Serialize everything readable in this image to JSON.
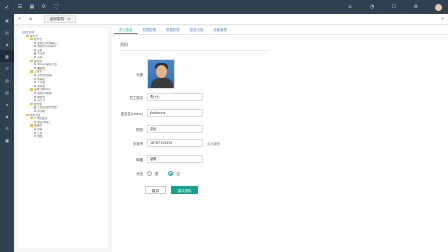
{
  "tab": {
    "label": "组织架构",
    "close": "×"
  },
  "tree": {
    "root": "[我的]权限",
    "nodes": [
      {
        "type": "folder",
        "label": "曹六七",
        "indent": 1
      },
      {
        "type": "folder",
        "label": "研六七",
        "indent": 2
      },
      {
        "type": "user",
        "label": "张晓(贝尔)的职工",
        "indent": 3
      },
      {
        "type": "user",
        "label": "刘晓宁(Amgen)",
        "indent": 3
      },
      {
        "type": "user",
        "label": "庄斯",
        "indent": 3
      },
      {
        "type": "user",
        "label": "李子彦",
        "indent": 3
      },
      {
        "type": "user",
        "label": "苏丹",
        "indent": 3
      },
      {
        "type": "folder",
        "label": "运营部",
        "indent": 2
      },
      {
        "type": "user",
        "label": "Xinyu(深圳)上班",
        "indent": 3
      },
      {
        "type": "user",
        "label": "曹六七",
        "indent": 3,
        "selected": true
      },
      {
        "type": "folder",
        "label": "工程部",
        "indent": 2
      },
      {
        "type": "user",
        "label": "乔文杰(新闻)",
        "indent": 3
      },
      {
        "type": "user",
        "label": "刘林研",
        "indent": 3
      },
      {
        "type": "user",
        "label": "王小波",
        "indent": 3
      },
      {
        "type": "user",
        "label": "周丹研",
        "indent": 3
      },
      {
        "type": "folder",
        "label": "深圳分部DCA",
        "indent": 2
      },
      {
        "type": "user",
        "label": "胡晓(市场部)",
        "indent": 3
      },
      {
        "type": "user",
        "label": "杨文彦",
        "indent": 3
      },
      {
        "type": "user",
        "label": "马小飞",
        "indent": 3
      },
      {
        "type": "folder",
        "label": "财务部",
        "indent": 2
      },
      {
        "type": "user",
        "label": "王丹晨(财务主管)",
        "indent": 3
      },
      {
        "type": "user",
        "label": "周小楠",
        "indent": 3
      },
      {
        "type": "folder",
        "label": "财务九部",
        "indent": 1
      },
      {
        "type": "folder",
        "label": "广州研发部",
        "indent": 2
      },
      {
        "type": "user",
        "label": "周丹(测试)",
        "indent": 3
      },
      {
        "type": "folder",
        "label": "视频部",
        "indent": 2
      },
      {
        "type": "user",
        "label": "韩丽",
        "indent": 3
      },
      {
        "type": "user",
        "label": "江丹",
        "indent": 3
      },
      {
        "type": "user",
        "label": "刘晓",
        "indent": 3
      }
    ]
  },
  "panel": {
    "tabs": [
      "员工信息",
      "权限配置",
      "数据权限",
      "登录记录",
      "设备管理"
    ],
    "title": "资料",
    "avatar_label": "头像",
    "fields": {
      "name_label": "员工姓名",
      "name_value": "曹六七",
      "en_label": "英文名(Users)",
      "en_value": "Katharina",
      "job_label": "职务",
      "job_value": "总经",
      "phone_label": "手机号",
      "phone_value": "18767155430",
      "phone_hint": "点击编辑",
      "email_label": "邮箱",
      "email_value": "副教"
    },
    "gender": {
      "label": "状态",
      "opt1": "是",
      "opt2": "否"
    },
    "buttons": {
      "back": "取消",
      "save": "保存资料"
    }
  }
}
